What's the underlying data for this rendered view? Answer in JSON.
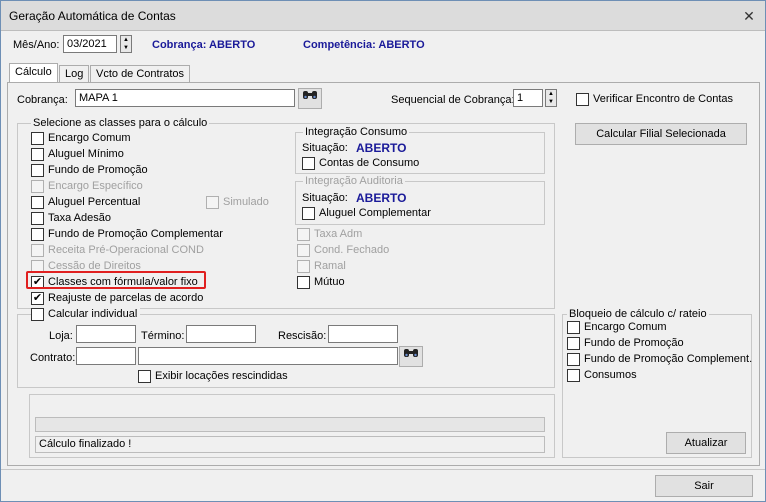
{
  "window": {
    "title": "Geração Automática de Contas",
    "close_label": "✕"
  },
  "header": {
    "mes_ano_label": "Mês/Ano:",
    "mes_ano_value": "03/2021",
    "cobranca_status": "Cobrança: ABERTO",
    "competencia_status": "Competência: ABERTO"
  },
  "tabs": [
    {
      "label": "Cálculo",
      "active": true
    },
    {
      "label": "Log",
      "active": false
    },
    {
      "label": "Vcto de Contratos",
      "active": false
    }
  ],
  "calc": {
    "cobranca_label": "Cobrança:",
    "cobranca_value": "MAPA 1",
    "sequencial_label": "Sequencial de Cobrança:",
    "sequencial_value": "1",
    "verificar_label": "Verificar Encontro de Contas",
    "calcular_filial_button": "Calcular Filial Selecionada",
    "classes_group_title": "Selecione as classes para o cálculo",
    "classes": [
      {
        "label": "Encargo Comum",
        "checked": false,
        "enabled": true
      },
      {
        "label": "Aluguel Mínimo",
        "checked": false,
        "enabled": true
      },
      {
        "label": "Fundo de Promoção",
        "checked": false,
        "enabled": true
      },
      {
        "label": "Encargo Específico",
        "checked": false,
        "enabled": false
      },
      {
        "label": "Aluguel Percentual",
        "checked": false,
        "enabled": true
      },
      {
        "label": "Taxa Adesão",
        "checked": false,
        "enabled": true
      },
      {
        "label": "Fundo de Promoção Complementar",
        "checked": false,
        "enabled": true
      },
      {
        "label": "Receita Pré-Operacional COND",
        "checked": false,
        "enabled": false
      },
      {
        "label": "Cessão de Direitos",
        "checked": false,
        "enabled": false
      },
      {
        "label": "Classes com fórmula/valor fixo",
        "checked": true,
        "enabled": true
      },
      {
        "label": "Reajuste de parcelas de acordo",
        "checked": true,
        "enabled": true
      }
    ],
    "simulado_label": "Simulado",
    "right_classes": [
      {
        "label": "Taxa Adm",
        "checked": false,
        "enabled": false
      },
      {
        "label": "Cond. Fechado",
        "checked": false,
        "enabled": false
      },
      {
        "label": "Ramal",
        "checked": false,
        "enabled": false
      },
      {
        "label": "Mútuo",
        "checked": false,
        "enabled": true
      }
    ],
    "integracao_consumo": {
      "title": "Integração Consumo",
      "situacao_label": "Situação:",
      "situacao_value": "ABERTO",
      "checkbox_label": "Contas de Consumo"
    },
    "integracao_auditoria": {
      "title": "Integração Auditoria",
      "situacao_label": "Situação:",
      "situacao_value": "ABERTO",
      "checkbox_label": "Aluguel Complementar"
    },
    "individual": {
      "title": "Calcular individual",
      "loja_label": "Loja:",
      "termino_label": "Término:",
      "rescisao_label": "Rescisão:",
      "contrato_label": "Contrato:",
      "exibir_label": "Exibir locações rescindidas"
    },
    "status_message": "Cálculo finalizado !",
    "bloqueio": {
      "title": "Bloqueio de cálculo c/ rateio",
      "items": [
        "Encargo Comum",
        "Fundo de Promoção",
        "Fundo de Promoção Complement.",
        "Consumos"
      ],
      "atualizar_button": "Atualizar"
    }
  },
  "footer": {
    "sair_button": "Sair"
  }
}
